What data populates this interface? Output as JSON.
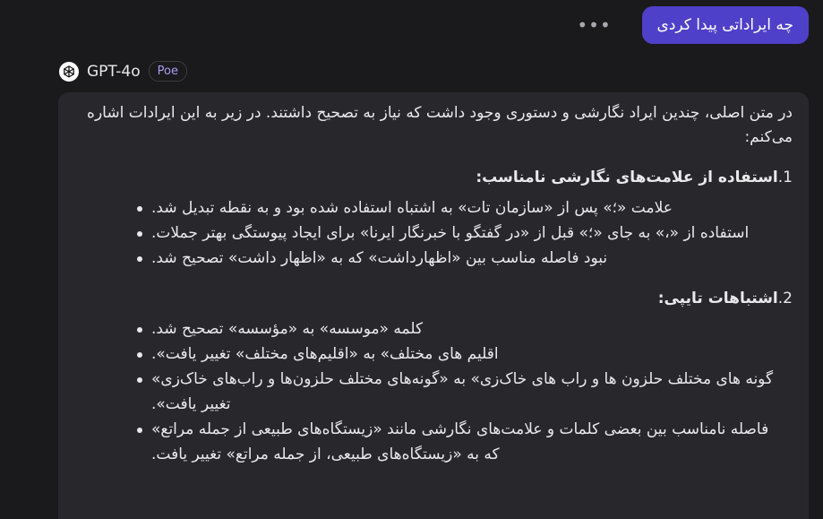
{
  "user_message": {
    "text": "چه ایراداتی پیدا کردی"
  },
  "more_options": {
    "label": "•••"
  },
  "bot": {
    "name": "GPT-4o",
    "badge": "Poe"
  },
  "response": {
    "intro": "در متن اصلی، چندین ایراد نگارشی و دستوری وجود داشت که نیاز به تصحیح داشتند. در زیر به این ایرادات اشاره می‌کنم:",
    "sections": [
      {
        "number": "1.",
        "title": "استفاده از علامت‌های نگارشی نامناسب:",
        "items": [
          "علامت «؛» پس از «سازمان تات» به اشتباه استفاده شده بود و به نقطه تبدیل شد.",
          "استفاده از «،» به جای «؛» قبل از «در گفتگو با خبرنگار ایرنا» برای ایجاد پیوستگی بهتر جملات.",
          "نبود فاصله مناسب بین «اظهارداشت» که به «اظهار داشت» تصحیح شد."
        ]
      },
      {
        "number": "2.",
        "title": "اشتباهات تایپی:",
        "items": [
          "کلمه «موسسه» به «مؤسسه» تصحیح شد.",
          "اقلیم های مختلف» به «اقلیم‌های مختلف» تغییر یافت».",
          "گونه های مختلف حلزون ها و راب های خاک‌زی» به «گونه‌های مختلف حلزون‌ها و راب‌های خاک‌زی» تغییر یافت».",
          "فاصله نامناسب بین بعضی کلمات و علامت‌های نگارشی مانند «زیستگاه‌های طبیعی از جمله مراتع» که به «زیستگاه‌های طبیعی، از جمله مراتع» تغییر یافت."
        ]
      }
    ]
  },
  "colors": {
    "background": "#1a1a1c",
    "user_bubble": "#4f40c9",
    "bot_bubble": "#28282c",
    "badge_text": "#a99cf3"
  },
  "icons": {
    "more": "more-dots-icon",
    "avatar": "openai-logo-icon"
  }
}
